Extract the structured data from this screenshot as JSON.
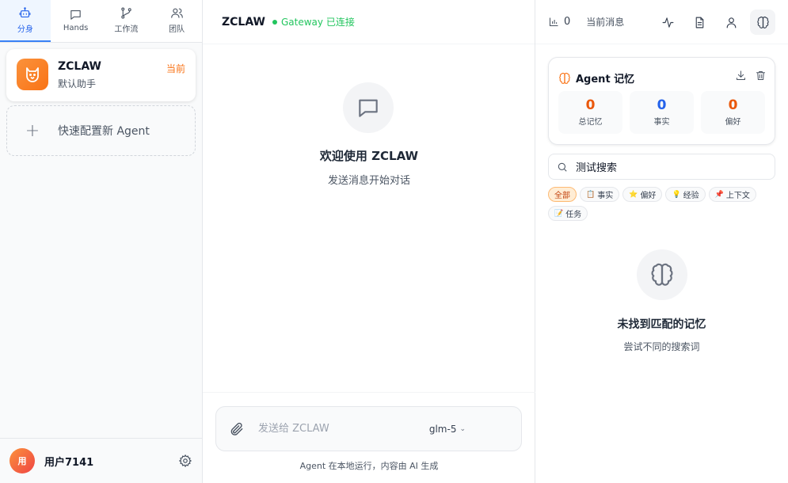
{
  "sidebar": {
    "tabs": [
      {
        "label": "分身",
        "icon": "bot-icon",
        "active": true
      },
      {
        "label": "Hands",
        "icon": "message-square-icon",
        "active": false
      },
      {
        "label": "工作流",
        "icon": "git-branch-icon",
        "active": false
      },
      {
        "label": "团队",
        "icon": "users-icon",
        "active": false
      }
    ],
    "agent": {
      "name": "ZCLAW",
      "subtitle": "默认助手",
      "badge": "当前",
      "icon": "cat-icon"
    },
    "quick_add": {
      "label": "快速配置新 Agent"
    },
    "user": {
      "avatar_text": "用",
      "name": "用户7141"
    }
  },
  "chat": {
    "title": "ZCLAW",
    "status": "Gateway 已连接",
    "status_color": "#22c55e",
    "welcome_title": "欢迎使用 ZCLAW",
    "welcome_subtitle": "发送消息开始对话",
    "composer": {
      "placeholder": "发送给 ZCLAW",
      "model": "glm-5"
    },
    "note": "Agent 在本地运行，内容由 AI 生成"
  },
  "panel": {
    "message_count": "0",
    "current_label": "当前消息",
    "memory": {
      "title": "Agent 记忆",
      "stats": [
        {
          "value": "0",
          "label": "总记忆",
          "color": "#ea580c"
        },
        {
          "value": "0",
          "label": "事实",
          "color": "#2563eb"
        },
        {
          "value": "0",
          "label": "偏好",
          "color": "#ea580c"
        }
      ]
    },
    "search": {
      "value": "测试搜索"
    },
    "filters": [
      {
        "label": "全部",
        "icon": "",
        "active": true
      },
      {
        "label": "事实",
        "icon": "📋",
        "active": false
      },
      {
        "label": "偏好",
        "icon": "⭐",
        "active": false
      },
      {
        "label": "经验",
        "icon": "💡",
        "active": false
      },
      {
        "label": "上下文",
        "icon": "📌",
        "active": false
      },
      {
        "label": "任务",
        "icon": "📝",
        "active": false
      }
    ],
    "empty_title": "未找到匹配的记忆",
    "empty_subtitle": "尝试不同的搜索词"
  },
  "colors": {
    "accent": "#3b82f6",
    "brand": "#f97316"
  }
}
